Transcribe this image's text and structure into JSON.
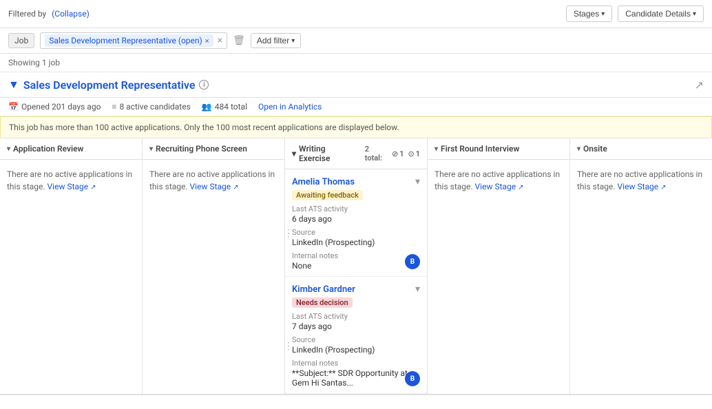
{
  "topbar": {
    "stages_label": "Stages",
    "candidate_details_label": "Candidate Details"
  },
  "filter": {
    "filtered_by": "Filtered by",
    "collapse_label": "(Collapse)",
    "job_label": "Job",
    "chip_value": "Sales Development Representative (open)",
    "add_filter_label": "Add filter"
  },
  "showing": {
    "text": "Showing 1 job"
  },
  "job": {
    "title": "Sales Development Representative",
    "opened": "Opened 201 days ago",
    "active_candidates": "8 active candidates",
    "total": "484 total",
    "open_analytics": "Open in Analytics"
  },
  "warning": {
    "text": "This job has more than 100 active applications. Only the 100 most recent applications are displayed below."
  },
  "stages": [
    {
      "name": "Application Review",
      "empty": true,
      "empty_text": "There are no active applications in this stage.",
      "view_stage_label": "View Stage"
    },
    {
      "name": "Recruiting Phone Screen",
      "empty": true,
      "empty_text": "There are no active applications in this stage.",
      "view_stage_label": "View Stage"
    },
    {
      "name": "Writing Exercise",
      "empty": false,
      "count_total": "2 total:",
      "count_open": "1",
      "count_1": "1"
    },
    {
      "name": "First Round Interview",
      "empty": true,
      "empty_text": "There are no active applications in this stage.",
      "view_stage_label": "View Stage"
    },
    {
      "name": "Onsite",
      "empty": true,
      "empty_text": "There are no active applications in this stage.",
      "view_stage_label": "View Stage"
    }
  ],
  "candidates": [
    {
      "name": "Amelia Thomas",
      "status": "Awaiting feedback",
      "status_type": "awaiting",
      "ats_label": "Last ATS activity",
      "ats_value": "6 days ago",
      "source_label": "Source",
      "source_value": "LinkedIn (Prospecting)",
      "notes_label": "Internal notes",
      "notes_value": "None",
      "avatar": "B"
    },
    {
      "name": "Kimber Gardner",
      "status": "Needs decision",
      "status_type": "needs-decision",
      "ats_label": "Last ATS activity",
      "ats_value": "7 days ago",
      "source_label": "Source",
      "source_value": "LinkedIn (Prospecting)",
      "notes_label": "Internal notes",
      "notes_value": "**Subject:** SDR Opportunity at Gem Hi Santas...",
      "avatar": "B"
    }
  ],
  "icons": {
    "chevron_down": "▾",
    "info": "i",
    "share": "↗",
    "calendar": "📅",
    "people": "👥",
    "person": "👤",
    "more": "⋮",
    "dropdown_arrow": "▾",
    "close": "×",
    "trash": "🗑"
  }
}
